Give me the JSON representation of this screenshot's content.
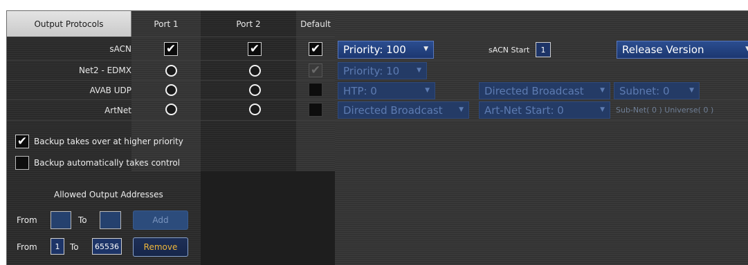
{
  "header": {
    "tabs": [
      "Output Protocols",
      "Port 1",
      "Port 2",
      "Default"
    ]
  },
  "rows": [
    {
      "label": "sACN"
    },
    {
      "label": "Net2 - EDMX"
    },
    {
      "label": "AVAB UDP"
    },
    {
      "label": "ArtNet"
    }
  ],
  "sacn": {
    "priority": "Priority: 100",
    "start_label": "sACN Start",
    "start_value": "1",
    "version": "Release Version"
  },
  "net2": {
    "priority": "Priority: 10"
  },
  "avab": {
    "htp": "HTP: 0",
    "broadcast": "Directed Broadcast",
    "subnet": "Subnet: 0"
  },
  "artnet": {
    "broadcast": "Directed Broadcast",
    "start": "Art-Net Start: 0",
    "subnet_universe": "Sub-Net( 0 ) Universe( 0 )"
  },
  "options": {
    "backup_priority": "Backup takes over at higher priority",
    "backup_auto": "Backup automatically takes control"
  },
  "allowed": {
    "title": "Allowed Output Addresses",
    "from_label": "From",
    "to_label": "To",
    "add_label": "Add",
    "remove_label": "Remove",
    "from_value": "1",
    "to_value": "65536"
  },
  "colors": {
    "accent_blue": "#2b4d90",
    "remove_text": "#f0b73a"
  }
}
